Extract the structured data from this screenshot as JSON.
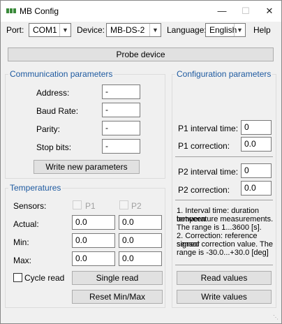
{
  "window": {
    "title": "MB Config",
    "minimize_glyph": "—",
    "maximize_glyph": "☐",
    "close_glyph": "✕"
  },
  "toolbar": {
    "port_label": "Port:",
    "port_value": "COM1",
    "device_label": "Device:",
    "device_value": "MB-DS-2",
    "language_label": "Language:",
    "language_value": "English",
    "help_label": "Help"
  },
  "probe_button": "Probe device",
  "communication": {
    "title": "Communication parameters",
    "address_label": "Address:",
    "address_value": "-",
    "baud_label": "Baud Rate:",
    "baud_value": "-",
    "parity_label": "Parity:",
    "parity_value": "-",
    "stopbits_label": "Stop bits:",
    "stopbits_value": "-",
    "write_button": "Write new parameters"
  },
  "temperatures": {
    "title": "Temperatures",
    "sensors_label": "Sensors:",
    "p1_label": "P1",
    "p2_label": "P2",
    "actual_label": "Actual:",
    "actual_p1": "0.0",
    "actual_p2": "0.0",
    "min_label": "Min:",
    "min_p1": "0.0",
    "min_p2": "0.0",
    "max_label": "Max:",
    "max_p1": "0.0",
    "max_p2": "0.0",
    "cycle_label": "Cycle read",
    "single_read_button": "Single read",
    "reset_button": "Reset Min/Max"
  },
  "configuration": {
    "title": "Configuration parameters",
    "p1_interval_label": "P1 interval time:",
    "p1_interval_value": "0",
    "p1_correction_label": "P1 correction:",
    "p1_correction_value": "0.0",
    "p2_interval_label": "P2 interval time:",
    "p2_interval_value": "0",
    "p2_correction_label": "P2 correction:",
    "p2_correction_value": "0.0",
    "note_lines": [
      "1. Interval time: duration between",
      "temperature measurements.",
      "The range is 1...3600 [s].",
      "2. Correction: reference sensor",
      "signed correction value. The",
      "range is -30.0...+30.0 [deg]"
    ],
    "read_button": "Read values",
    "write_button": "Write values"
  },
  "icons": {
    "app": "app-icon",
    "dropdown": "chevron-down-icon",
    "resize": "resize-grip-icon"
  }
}
